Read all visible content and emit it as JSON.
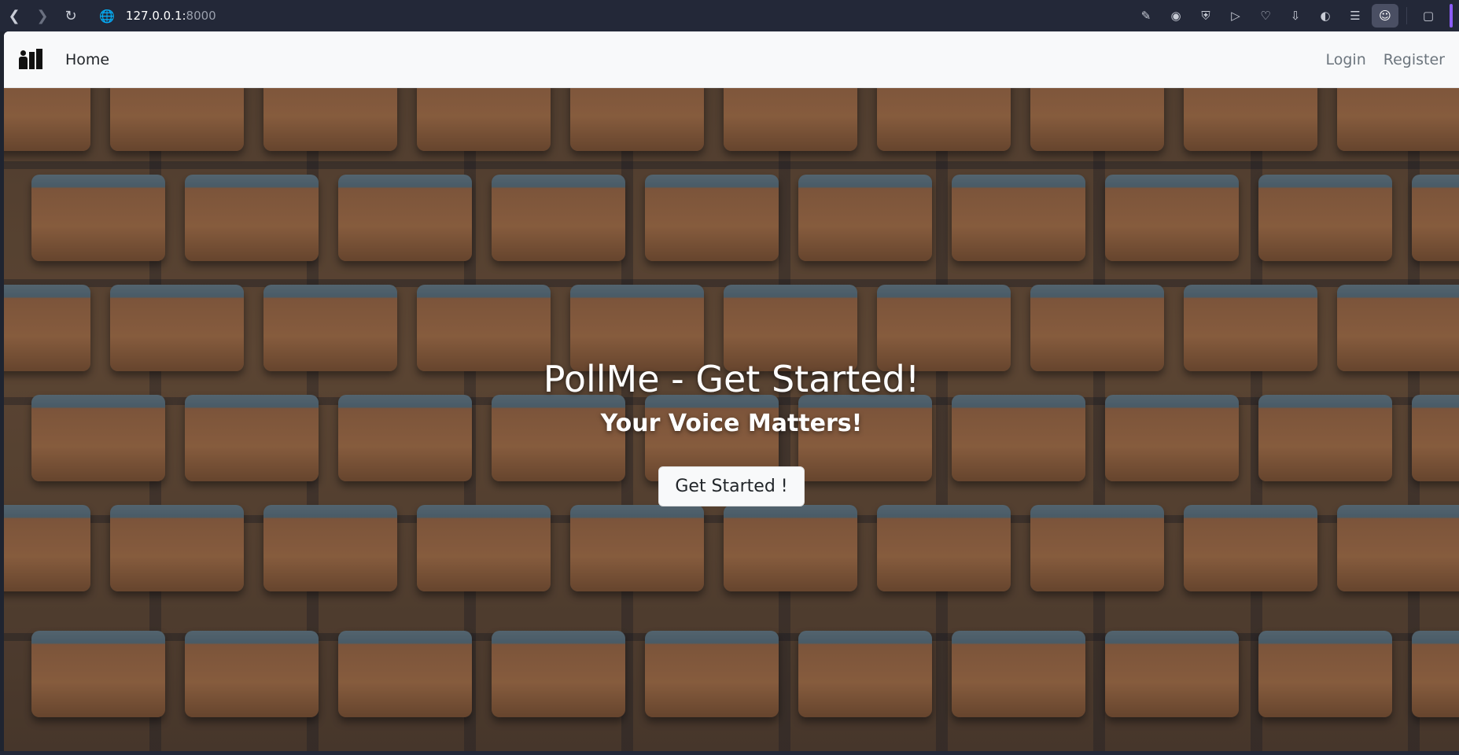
{
  "browser": {
    "url_host": "127.0.0.1:",
    "url_port": "8000",
    "toolbar_icons": [
      "edit-icon",
      "camera-icon",
      "shield-icon",
      "play-icon",
      "heart-icon",
      "download-icon",
      "sidebar-icon",
      "menu-icon",
      "profile-icon",
      "extensions-icon"
    ]
  },
  "navbar": {
    "home_label": "Home",
    "login_label": "Login",
    "register_label": "Register"
  },
  "hero": {
    "title": "PollMe - Get Started!",
    "subtitle": "Your Voice Matters!",
    "button_label": "Get Started !"
  },
  "colors": {
    "navbar_bg": "#f8f9fa",
    "browser_bg": "#232838",
    "accent": "#8b5cf6"
  }
}
